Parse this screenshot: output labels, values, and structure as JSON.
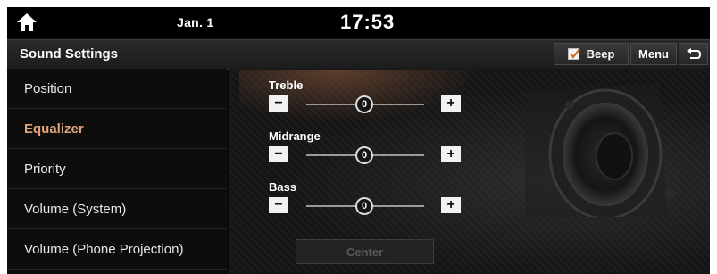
{
  "status_bar": {
    "home_icon": "home-icon",
    "date": "Jan. 1",
    "time": "17:53"
  },
  "title_bar": {
    "title": "Sound Settings",
    "beep_label": "Beep",
    "beep_checked": true,
    "menu_label": "Menu",
    "back_icon": "back-arrow-icon"
  },
  "sidebar": {
    "items": [
      {
        "label": "Position",
        "active": false
      },
      {
        "label": "Equalizer",
        "active": true
      },
      {
        "label": "Priority",
        "active": false
      },
      {
        "label": "Volume (System)",
        "active": false
      },
      {
        "label": "Volume (Phone Projection)",
        "active": false
      }
    ]
  },
  "equalizer": {
    "treble": {
      "label": "Treble",
      "value": "0"
    },
    "midrange": {
      "label": "Midrange",
      "value": "0"
    },
    "bass": {
      "label": "Bass",
      "value": "0"
    },
    "minus_symbol": "−",
    "plus_symbol": "+",
    "center_label": "Center"
  },
  "colors": {
    "active_item": "#e0a27a",
    "background": "#0a0a0a"
  }
}
